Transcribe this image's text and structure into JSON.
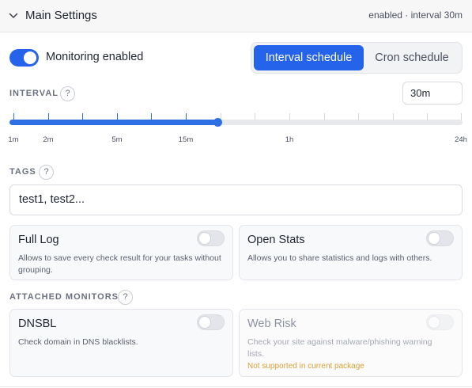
{
  "header": {
    "title": "Main Settings",
    "summary": "enabled · interval 30m"
  },
  "monitoring": {
    "label": "Monitoring enabled",
    "enabled": true
  },
  "schedule": {
    "options": [
      "Interval schedule",
      "Cron schedule"
    ],
    "selected": "Interval schedule"
  },
  "interval": {
    "label": "INTERVAL",
    "help": "?",
    "value": "30m",
    "slider_level": 0.46,
    "tick_labels": [
      "1m",
      "2m",
      "5m",
      "15m",
      "1h",
      "24h"
    ]
  },
  "tags": {
    "label": "TAGS",
    "help": "?",
    "placeholder": "test1, test2..."
  },
  "options": {
    "full_log": {
      "title": "Full Log",
      "description": "Allows to save every check result for your tasks without grouping.",
      "enabled": false
    },
    "open_stats": {
      "title": "Open Stats",
      "description": "Allows you to share statistics and logs with others.",
      "enabled": false
    }
  },
  "attached_monitors": {
    "label": "ATTACHED MONITORS",
    "help": "?",
    "dnsbl": {
      "title": "DNSBL",
      "description": "Check domain in DNS blacklists.",
      "enabled": false
    },
    "web_risk": {
      "title": "Web Risk",
      "description": "Check your site against malware/phishing warning lists.",
      "note": "Not supported in current package",
      "enabled": false,
      "disabled": true
    }
  },
  "colors": {
    "accent": "#2563eb",
    "warning_note": "#d9a13b"
  },
  "icons": {
    "collapse": "chevron-down-icon",
    "help": "help-circle-icon"
  }
}
